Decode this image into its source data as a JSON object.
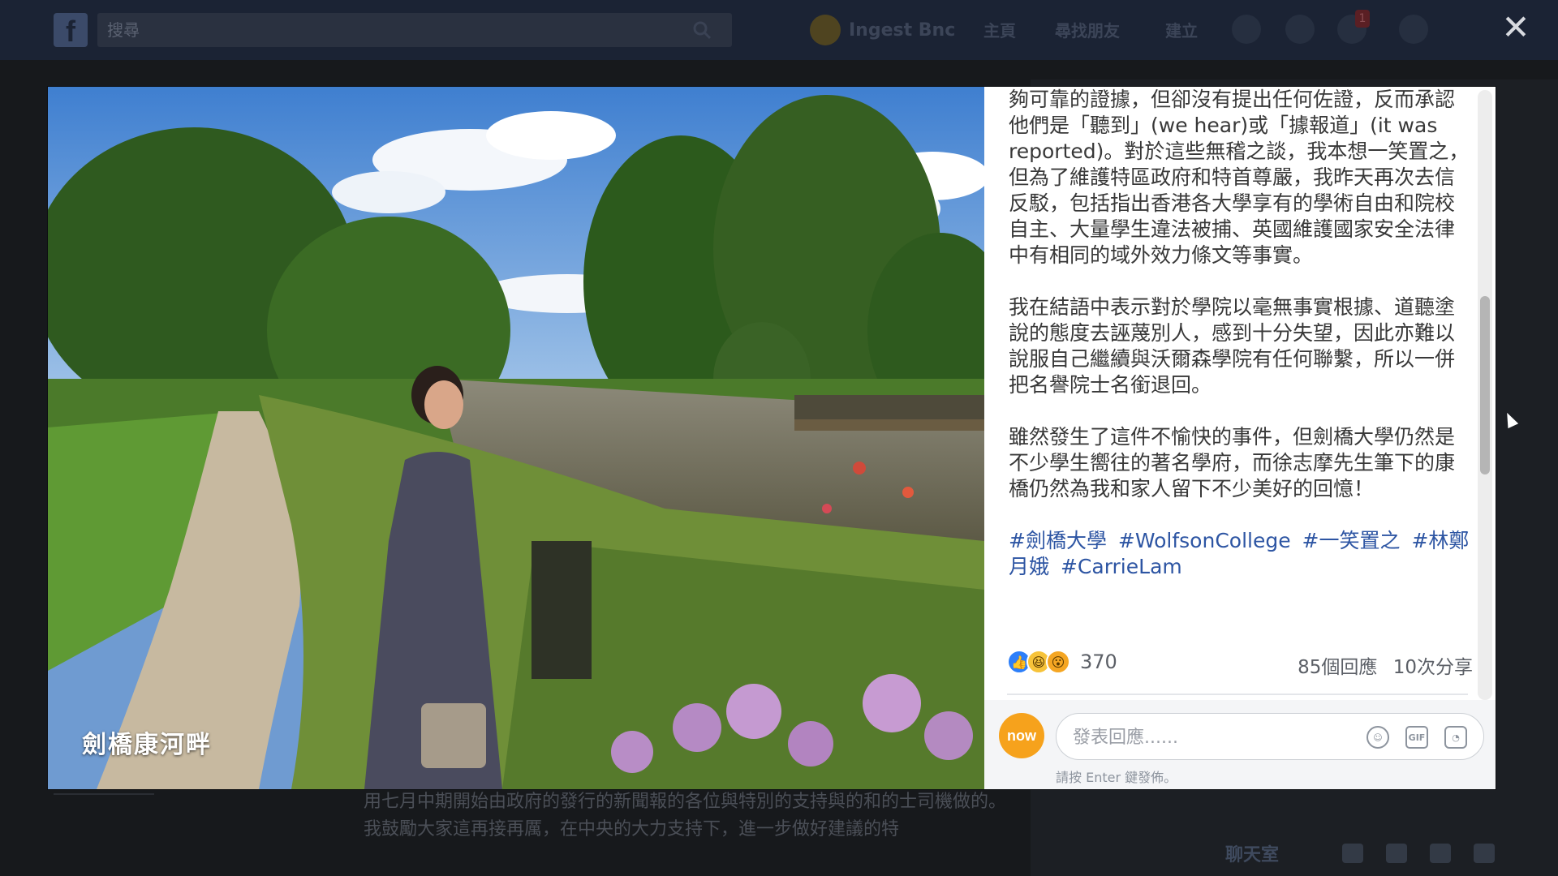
{
  "topbar": {
    "logo": "f",
    "search_placeholder": "搜尋",
    "user_name": "Ingest Bnc",
    "nav_links": [
      "主頁",
      "尋找朋友",
      "建立"
    ],
    "notification_count": "1"
  },
  "close_label": "✕",
  "background": {
    "post_lines": [
      "用七月中期開始由政府的發行的新聞報的各位與特別的支持與的和的士司機做的。",
      "我鼓勵大家這再接再厲，在中央的大力支持下，進一步做好建議的特"
    ],
    "chat_label": "聊天室"
  },
  "photo": {
    "caption": "劍橋康河畔"
  },
  "post": {
    "paragraphs": [
      "夠可靠的證據，但卻沒有提出任何佐證，反而承認他們是「聽到」(we hear)或「據報道」(it was reported)。對於這些無稽之談，我本想一笑置之，但為了維護特區政府和特首尊嚴，我昨天再次去信反駁，包括指出香港各大學享有的學術自由和院校自主、大量學生違法被捕、英國維護國家安全法律中有相同的域外效力條文等事實。",
      "我在結語中表示對於學院以毫無事實根據、道聽塗說的態度去誣蔑別人，感到十分失望，因此亦難以說服自己繼續與沃爾森學院有任何聯繫，所以一併把名譽院士名銜退回。",
      "雖然發生了這件不愉快的事件，但劍橋大學仍然是不少學生嚮往的著名學府，而徐志摩先生筆下的康橋仍然為我和家人留下不少美好的回憶！"
    ],
    "hashtags": [
      "#劍橋大學",
      "#WolfsonCollege",
      "#一笑置之",
      "#林鄭月娥",
      "#CarrieLam"
    ]
  },
  "engagement": {
    "reaction_count": "370",
    "comments": "85個回應",
    "shares": "10次分享"
  },
  "comment": {
    "avatar_text": "now",
    "placeholder": "發表回應......",
    "gif_label": "GIF",
    "hint": "請按 Enter 鍵發佈。"
  },
  "colors": {
    "link": "#2d55a3",
    "like_blue": "#2d7ff9",
    "topbar": "#1b2334"
  }
}
